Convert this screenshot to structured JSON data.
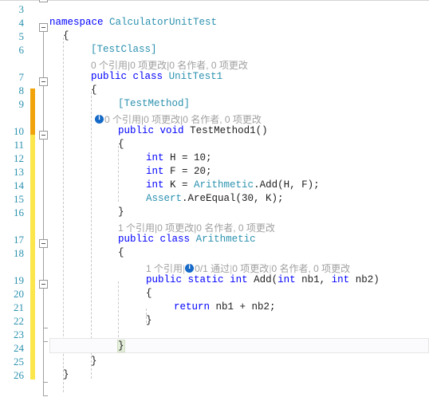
{
  "editor": {
    "language": "csharp",
    "first_visible_line": 3,
    "last_visible_line": 26,
    "current_line": 23,
    "colors": {
      "keyword": "#0000ff",
      "type": "#2b91af",
      "text": "#202020",
      "line_number": "#2b91af",
      "codelens": "#a0a0a0",
      "change_bar_saved": "#f0a30a",
      "change_bar_unsaved": "#fbe74b",
      "badge": "#1569c7",
      "brace_match": "#e4eedb",
      "background": "#ffffff"
    }
  },
  "line_numbers": [
    3,
    4,
    5,
    6,
    7,
    8,
    9,
    10,
    11,
    12,
    13,
    14,
    15,
    16,
    17,
    18,
    19,
    20,
    21,
    22,
    23,
    24,
    25,
    26
  ],
  "code_lines": [
    {
      "n": 3,
      "indent": 0,
      "text": ""
    },
    {
      "n": 4,
      "indent": 0,
      "text": "namespace CalculatorUnitTest",
      "fold": true
    },
    {
      "n": 5,
      "indent": 0,
      "text": "{"
    },
    {
      "n": 6,
      "indent": 1,
      "text": "[TestClass]"
    },
    {
      "n": 7,
      "indent": 1,
      "text": "public class UnitTest1",
      "fold": true
    },
    {
      "n": 8,
      "indent": 1,
      "text": "{"
    },
    {
      "n": 9,
      "indent": 2,
      "text": "[TestMethod]"
    },
    {
      "n": 10,
      "indent": 2,
      "text": "public void TestMethod1()",
      "fold": true
    },
    {
      "n": 11,
      "indent": 2,
      "text": "{"
    },
    {
      "n": 12,
      "indent": 3,
      "text": "int H = 10;"
    },
    {
      "n": 13,
      "indent": 3,
      "text": "int F = 20;"
    },
    {
      "n": 14,
      "indent": 3,
      "text": "int K = Arithmetic.Add(H, F);"
    },
    {
      "n": 15,
      "indent": 3,
      "text": "Assert.AreEqual(30, K);"
    },
    {
      "n": 16,
      "indent": 2,
      "text": "}"
    },
    {
      "n": 17,
      "indent": 2,
      "text": "public class Arithmetic",
      "fold": true
    },
    {
      "n": 18,
      "indent": 2,
      "text": "{"
    },
    {
      "n": 19,
      "indent": 3,
      "text": "public static int Add(int nb1, int nb2)",
      "fold": true
    },
    {
      "n": 20,
      "indent": 3,
      "text": "{"
    },
    {
      "n": 21,
      "indent": 4,
      "text": "return nb1 + nb2;"
    },
    {
      "n": 22,
      "indent": 3,
      "text": "}"
    },
    {
      "n": 23,
      "indent": 2,
      "text": "}"
    },
    {
      "n": 24,
      "indent": 1,
      "text": "}"
    },
    {
      "n": 25,
      "indent": 0,
      "text": "}"
    },
    {
      "n": 26,
      "indent": 0,
      "text": ""
    }
  ],
  "tokens": {
    "ns_keyword": "namespace",
    "ns_name": "CalculatorUnitTest",
    "attr_testclass": "[TestClass]",
    "attr_testmethod": "[TestMethod]",
    "kw_public": "public",
    "kw_class": "class",
    "kw_void": "void",
    "kw_int": "int",
    "kw_static": "static",
    "kw_return": "return",
    "name_unittest1": "UnitTest1",
    "name_testmethod1": "TestMethod1()",
    "name_arithmetic_class": "Arithmetic",
    "type_arithmetic": "Arithmetic",
    "member_add": ".Add(H, F);",
    "type_assert": "Assert",
    "member_areequal": ".AreEqual(30, K);",
    "decl_h": "H = 10;",
    "decl_f": "F = 20;",
    "decl_k": "K = ",
    "sig_add": "Add(",
    "sig_nb1": "nb1, ",
    "sig_nb2": "nb2)",
    "ret_expr": "nb1 + nb2;",
    "brace_open": "{",
    "brace_close": "}"
  },
  "codelens": [
    {
      "id": "unittest1",
      "for_line": 7,
      "has_badge": false,
      "parts": [
        "0 个引用",
        "0 项更改",
        "0 名作者, 0 项更改"
      ],
      "full_text": "0 个引用|0 项更改|0 名作者, 0 项更改"
    },
    {
      "id": "testmethod1",
      "for_line": 10,
      "has_badge": true,
      "parts": [
        "0 个引用",
        "0 项更改",
        "0 名作者, 0 项更改"
      ],
      "full_text": "0 个引用|0 项更改|0 名作者, 0 项更改"
    },
    {
      "id": "arithmetic-class",
      "for_line": 17,
      "has_badge": false,
      "parts": [
        "1 个引用",
        "0 项更改",
        "0 名作者, 0 项更改"
      ],
      "full_text": "1 个引用|0 项更改|0 名作者, 0 项更改"
    },
    {
      "id": "add-method",
      "for_line": 19,
      "has_badge": true,
      "badge_after_text": "1 个引用",
      "parts": [
        "1 个引用",
        "0/1 通过",
        "0 项更改",
        "0 名作者, 0 项更改"
      ],
      "full_text": "1 个引用|0/1 通过|0 项更改|0 名作者, 0 项更改"
    }
  ],
  "codelens_labels": {
    "refs_0": "0 个引用",
    "refs_1": "1 个引用",
    "changes_0": "0 项更改",
    "authors_0": "0 名作者, 0 项更改",
    "tests_passing": "0/1 通过",
    "separator": "|"
  }
}
